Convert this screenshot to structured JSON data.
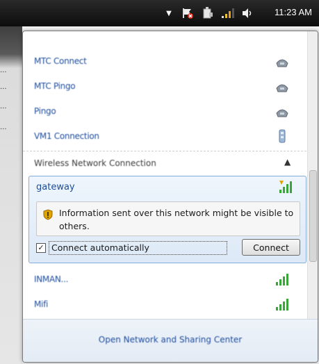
{
  "taskbar": {
    "clock": "11:23 AM",
    "icons": [
      "chevron-down-icon",
      "action-center-flag-icon",
      "device-icon",
      "network-signal-icon",
      "volume-icon"
    ]
  },
  "desktop_fragments": [
    "...",
    "...",
    "...",
    "..."
  ],
  "networks": [
    {
      "name": "MTC Connect",
      "icon": "dialup-icon"
    },
    {
      "name": "MTC Pingo",
      "icon": "dialup-icon"
    },
    {
      "name": "Pingo",
      "icon": "dialup-icon"
    },
    {
      "name": "VM1 Connection",
      "icon": "vpn-icon"
    }
  ],
  "wireless_section": {
    "label": "Wireless Network Connection",
    "arrow": "▲"
  },
  "selected_network": {
    "name": "gateway",
    "warning": "Information sent over this network might be visible to others.",
    "auto_connect_label": "Connect automatically",
    "auto_connect_checked": true,
    "connect_label": "Connect"
  },
  "other_networks": [
    {
      "name": "INMAN...",
      "icon": "wifi-signal-icon"
    },
    {
      "name": "Mifi",
      "icon": "wifi-signal-icon"
    }
  ],
  "footer": {
    "link": "Open Network and Sharing Center"
  },
  "colors": {
    "link": "#1c4c9c",
    "selected_border": "#84acdd",
    "signal_green": "#3aa63a",
    "warning_shield": "#e0a400"
  }
}
